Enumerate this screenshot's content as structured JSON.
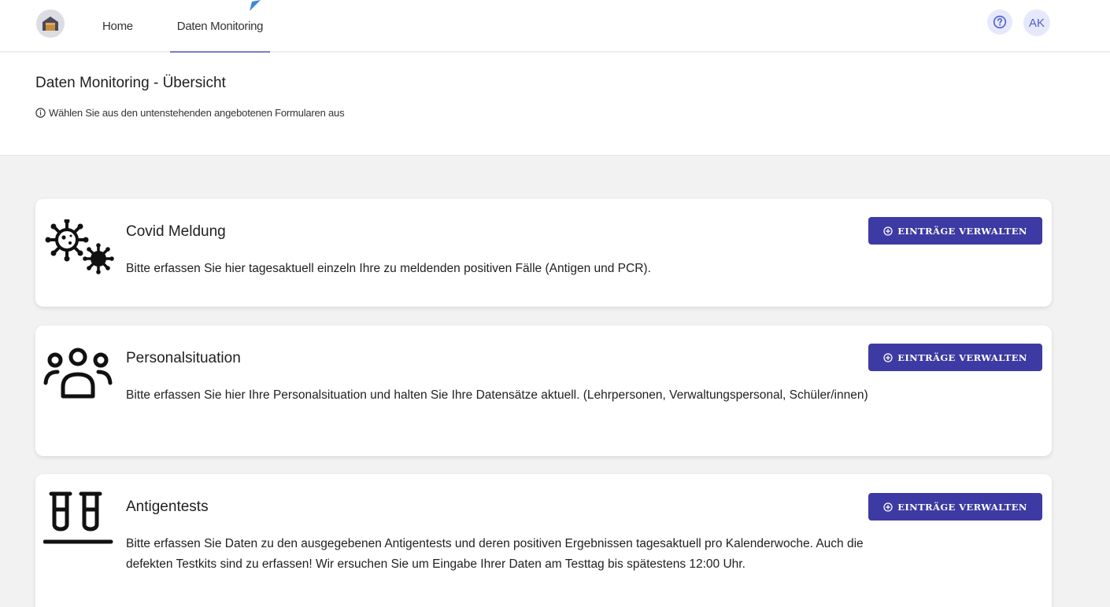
{
  "nav": {
    "home": "Home",
    "monitoring": "Daten Monitoring",
    "help_icon": "question-circle-icon",
    "avatar_initials": "AK"
  },
  "header": {
    "title": "Daten Monitoring - Übersicht",
    "subtitle": "Wählen Sie aus den untenstehenden angebotenen Formularen aus"
  },
  "cards": [
    {
      "icon": "virus-icon",
      "title": "Covid Meldung",
      "text": "Bitte erfassen Sie hier tagesaktuell einzeln Ihre zu meldenden positiven Fälle (Antigen und PCR).",
      "button": "EINTRÄGE VERWALTEN"
    },
    {
      "icon": "people-icon",
      "title": "Personalsituation",
      "text": "Bitte erfassen Sie hier Ihre Personalsituation und halten Sie Ihre Datensätze aktuell. (Lehrpersonen, Verwaltungspersonal, Schüler/innen)",
      "button": "EINTRÄGE VERWALTEN"
    },
    {
      "icon": "test-tubes-icon",
      "title": "Antigentests",
      "text": "Bitte erfassen Sie Daten zu den ausgegebenen Antigentests und deren positiven Ergebnissen tagesaktuell pro Kalenderwoche. Auch die defekten Testkits sind zu erfassen! Wir ersuchen Sie um Eingabe Ihrer Daten am Testtag bis spätestens 12:00 Uhr.",
      "button": "EINTRÄGE VERWALTEN"
    }
  ],
  "colors": {
    "primary_button": "#3d3aa3",
    "active_tab_underline": "#7e7cc8",
    "avatar_bg": "#e6e9fb",
    "page_bg": "#f2f2f2"
  }
}
